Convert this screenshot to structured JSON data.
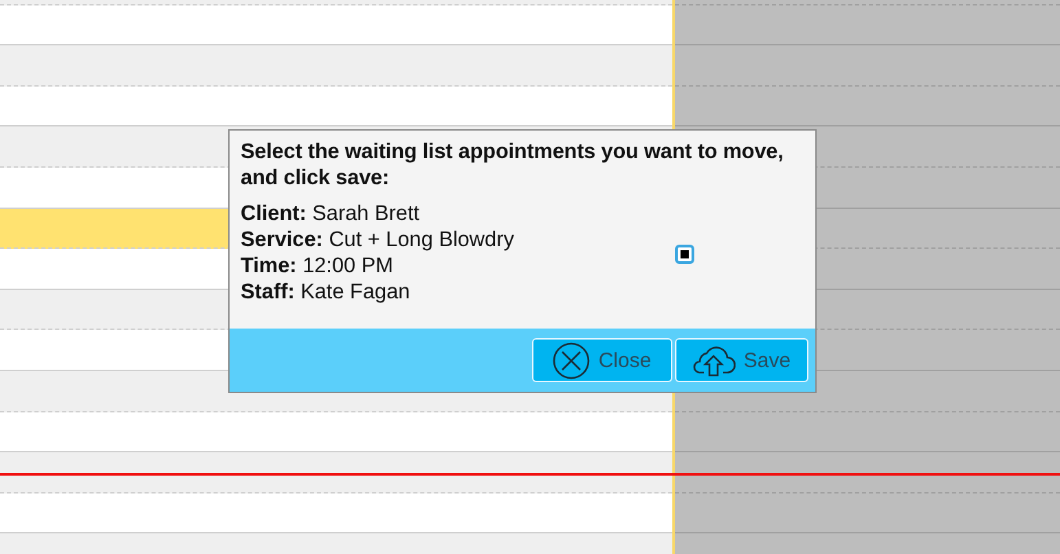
{
  "calendar": {
    "slots": [
      {
        "highlighted": false
      },
      {
        "highlighted": false
      },
      {
        "highlighted": false
      },
      {
        "highlighted": false
      },
      {
        "highlighted": false
      },
      {
        "highlighted": false
      },
      {
        "highlighted": true
      },
      {
        "highlighted": false
      },
      {
        "highlighted": false
      },
      {
        "highlighted": false
      },
      {
        "highlighted": false
      },
      {
        "highlighted": false
      },
      {
        "highlighted": false
      },
      {
        "highlighted": false
      },
      {
        "highlighted": false
      }
    ]
  },
  "dialog": {
    "heading": "Select the waiting list appointments you want to move, and click save:",
    "appointment": {
      "fields": [
        {
          "label": "Client:",
          "value": "Sarah Brett"
        },
        {
          "label": "Service:",
          "value": "Cut + Long Blowdry"
        },
        {
          "label": "Time:",
          "value": "12:00 PM"
        },
        {
          "label": "Staff:",
          "value": "Kate Fagan"
        }
      ],
      "checked": true
    },
    "buttons": [
      {
        "kind": "close",
        "label": "Close"
      },
      {
        "kind": "save",
        "label": "Save"
      }
    ]
  }
}
